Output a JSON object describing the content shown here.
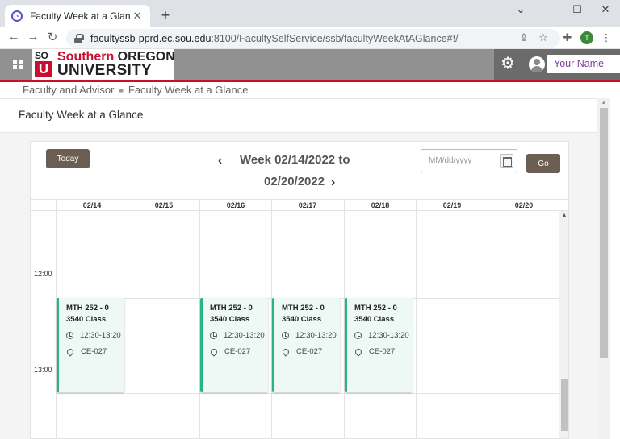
{
  "browser": {
    "tab_title": "Faculty Week at a Glance",
    "tab_close": "✕",
    "new_tab": "+",
    "url_host": "facultyssb-pprd.ec.sou.edu",
    "url_path": ":8100/FacultySelfService/ssb/facultyWeekAtAGlance#!/",
    "profile_initial": "T"
  },
  "header": {
    "logo_sou": "SO",
    "logo_u": "U",
    "logo_southern": "Southern",
    "logo_oregon": "OREGON",
    "logo_university": "UNIVERSITY",
    "user_name": "Your Name"
  },
  "breadcrumb": {
    "items": [
      "Faculty and Advisor",
      "Faculty Week at a Glance"
    ]
  },
  "page": {
    "title": "Faculty Week at a Glance"
  },
  "calendar": {
    "today_label": "Today",
    "week_line1": "Week 02/14/2022 to",
    "week_line2": "02/20/2022",
    "date_placeholder": "MM/dd/yyyy",
    "go_label": "Go",
    "days": [
      "02/14",
      "02/15",
      "02/16",
      "02/17",
      "02/18",
      "02/19",
      "02/20"
    ],
    "time_labels": [
      "12:00",
      "13:00"
    ],
    "events": [
      {
        "day": "02/14",
        "title": "MTH 252 - 0 3540 Class",
        "time": "12:30-13:20",
        "location": "CE-027"
      },
      {
        "day": "02/16",
        "title": "MTH 252 - 0 3540 Class",
        "time": "12:30-13:20",
        "location": "CE-027"
      },
      {
        "day": "02/17",
        "title": "MTH 252 - 0 3540 Class",
        "time": "12:30-13:20",
        "location": "CE-027"
      },
      {
        "day": "02/18",
        "title": "MTH 252 - 0 3540 Class",
        "time": "12:30-13:20",
        "location": "CE-027"
      }
    ]
  },
  "colors": {
    "brand_red": "#c8102e",
    "header_gray": "#919191",
    "button_brown": "#6b5e53",
    "event_accent": "#28b48a",
    "event_bg": "#eef8f4"
  }
}
